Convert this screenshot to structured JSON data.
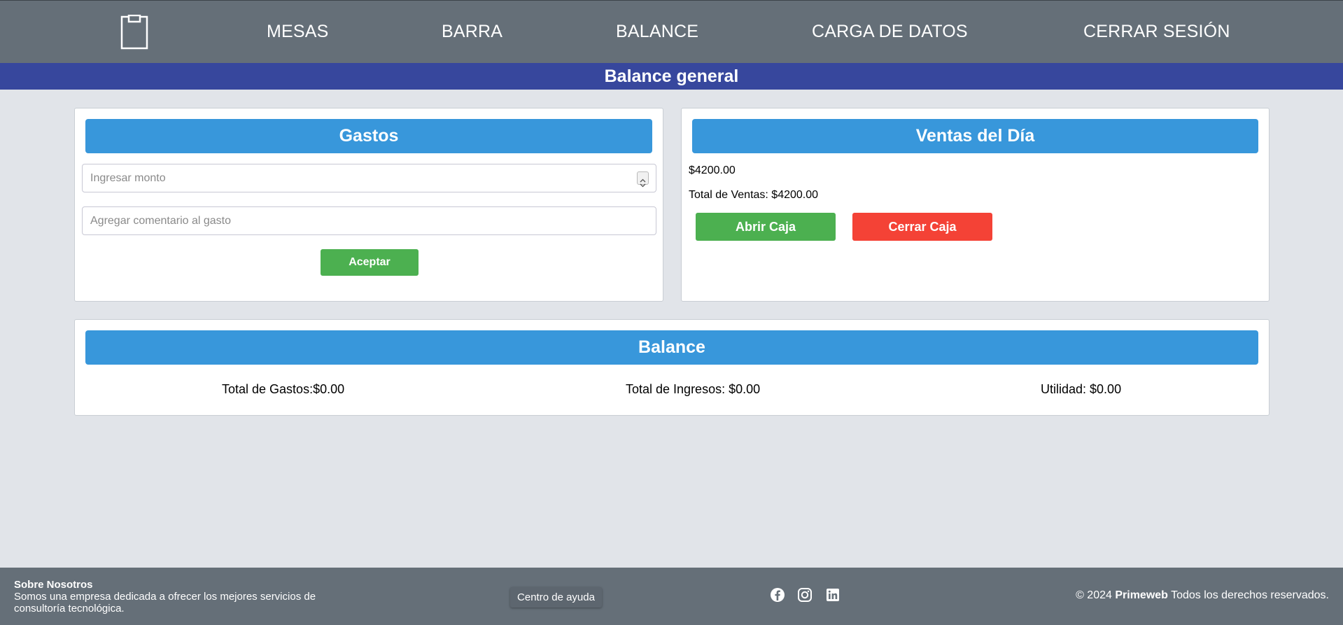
{
  "nav": {
    "logo_icon": "clipboard-icon",
    "items": [
      "MESAS",
      "BARRA",
      "BALANCE",
      "CARGA DE DATOS",
      "CERRAR SESIÓN"
    ]
  },
  "page_title": "Balance general",
  "gastos": {
    "header": "Gastos",
    "monto_placeholder": "Ingresar monto",
    "comentario_placeholder": "Agregar comentario al gasto",
    "accept_label": "Aceptar"
  },
  "ventas": {
    "header": "Ventas del Día",
    "amount": "$4200.00",
    "total_label": "Total de Ventas: $4200.00",
    "open_label": "Abrir Caja",
    "close_label": "Cerrar Caja"
  },
  "balance": {
    "header": "Balance",
    "total_gastos": "Total de Gastos:$0.00",
    "total_ingresos": "Total de Ingresos: $0.00",
    "utilidad": "Utilidad: $0.00"
  },
  "footer": {
    "about_title": "Sobre Nosotros",
    "about_text_line1": "Somos una empresa dedicada a ofrecer los mejores servicios de",
    "about_text_line2": "consultoría tecnológica.",
    "help_label": "Centro de ayuda",
    "social_icons": [
      "facebook-icon",
      "instagram-icon",
      "linkedin-icon"
    ],
    "copyright_prefix": "© 2024",
    "brand": "Primeweb",
    "copyright_suffix": "Todos los derechos reservados."
  },
  "colors": {
    "nav_bg": "#656f78",
    "title_bg": "#37479d",
    "header_blue": "#3897db",
    "green": "#4cb050",
    "red": "#f44236",
    "page_bg": "#e1e4e9"
  }
}
